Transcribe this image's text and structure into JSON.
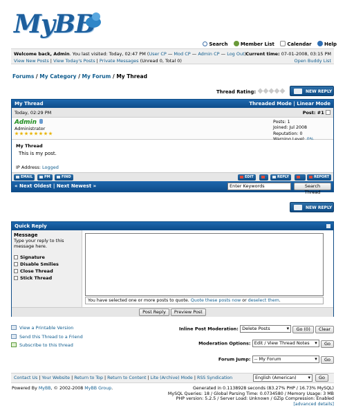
{
  "header": {
    "logo_text": "MyBB",
    "links": [
      {
        "label": "Search",
        "icon": "search-icon",
        "color": "#3d6fa8"
      },
      {
        "label": "Member List",
        "icon": "members-icon",
        "color": "#6a9a3a"
      },
      {
        "label": "Calendar",
        "icon": "calendar-icon",
        "color": "#a0a0a0"
      },
      {
        "label": "Help",
        "icon": "help-icon",
        "color": "#2f6fb4"
      }
    ]
  },
  "welcome": {
    "prefix": "Welcome back, ",
    "user": "Admin",
    "last_visit": ". You last visited: Today, 02:47 PM (",
    "user_cp": "User CP",
    "sep1": " — ",
    "mod_cp": "Mod CP",
    "sep2": " — ",
    "admin_cp": "Admin CP",
    "sep3": " — ",
    "log_out": "Log Out",
    "close": ")",
    "view_new": "View New Posts",
    "view_today": "View Today's Posts",
    "pm": "Private Messages",
    "pm_counts": " (Unread 0, Total 0)",
    "time_label": "Current time:",
    "time_value": " 07-01-2008, 03:15 PM",
    "buddy": "Open Buddy List"
  },
  "breadcrumb": {
    "forums": "Forums",
    "category": "My Category",
    "forum": "My Forum",
    "thread": "My Thread",
    "sep": " / "
  },
  "thread_rating_label": "Thread Rating:",
  "new_reply_label": "NEW REPLY",
  "thread": {
    "title": "My Thread",
    "threaded": "Threaded Mode",
    "linear": "Linear Mode",
    "mode_sep": " | ",
    "post_date": "Today, 02:29 PM",
    "post_num": "Post: #1",
    "author_name": "Admin",
    "author_title": "Administrator",
    "stats": {
      "posts": "Posts: 1",
      "joined": "Joined: Jul 2008",
      "reputation": "Reputation: 0",
      "warning_label": "Warning Level: ",
      "warning_value": "0%"
    },
    "post_subject": "My Thread",
    "post_message": "This is my post.",
    "ip_label": "IP Address: ",
    "ip_value": "Logged",
    "buttons_left": [
      "EMAIL",
      "PM",
      "FIND"
    ],
    "buttons_right": [
      "EDIT",
      "REPLY",
      "REPORT"
    ]
  },
  "nav": {
    "next_oldest": "« Next Oldest",
    "sep": " | ",
    "next_newest": "Next Newest »",
    "keywords": "Enter Keywords",
    "search_button": "Search Thread"
  },
  "quick_reply": {
    "title": "Quick Reply",
    "message_label": "Message",
    "message_hint": "Type your reply to this message here.",
    "options": [
      "Signature",
      "Disable Smilies",
      "Close Thread",
      "Stick Thread"
    ],
    "quote_text": "You have selected one or more posts to quote. ",
    "quote_link": "Quote these posts now",
    "quote_or": " or ",
    "quote_deselect": "deselect them",
    "quote_end": ".",
    "post_reply": "Post Reply",
    "preview": "Preview Post"
  },
  "tools": {
    "printable": "View a Printable Version",
    "send": "Send this Thread to a Friend",
    "subscribe": "Subscribe to this thread"
  },
  "moderation": {
    "inline_label": "Inline Post Moderation:",
    "inline_value": "Delete Posts",
    "inline_go": "Go (0)",
    "clear": "Clear",
    "options_label": "Moderation Options:",
    "options_value": "Edit / View Thread Notes",
    "go": "Go",
    "jump_label": "Forum Jump:",
    "jump_value": "-- My Forum"
  },
  "footer": {
    "contact": "Contact Us",
    "website": "Your Website",
    "top": "Return to Top",
    "content": "Return to Content",
    "lite": "Lite (Archive) Mode",
    "rss": "RSS Syndication",
    "sep": " | ",
    "language": "English (American)",
    "go": "Go",
    "powered_prefix": "Powered By ",
    "mybb": "MyBB",
    "copyright": ", © 2002-2008 ",
    "group": "MyBB Group",
    "copyright_end": ".",
    "debug1": "Generated in 0.1138928 seconds (83.27% PHP / 16.73% MySQL)",
    "debug2": "MySQL Queries: 18 / Global Parsing Time: 0.0734580 / Memory Usage: 3 MB",
    "debug3": "PHP version: 5.2.5 / Server Load: Unknown / GZip Compression: Enabled",
    "debug4": "[advanced details]"
  },
  "colors": {
    "header_blue": "#0d4c8a",
    "link": "#0f5c8e",
    "author_green": "#1c8c1c"
  }
}
